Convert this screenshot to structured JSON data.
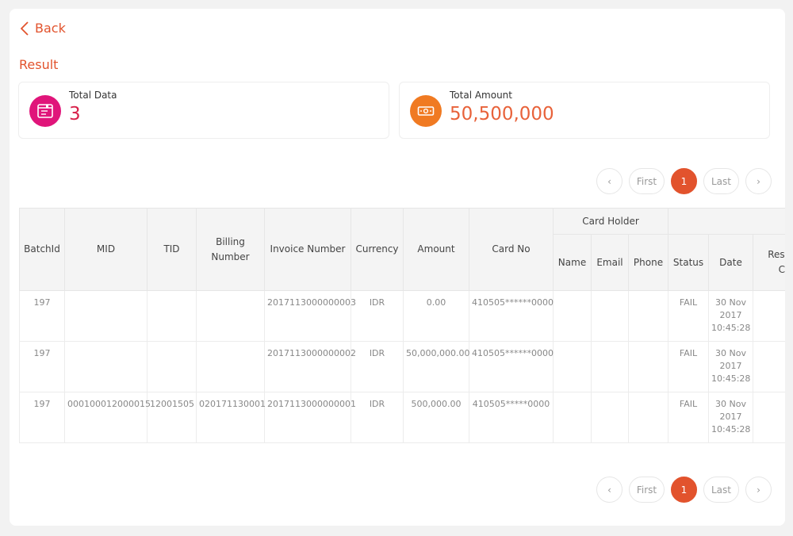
{
  "nav": {
    "back_label": "Back"
  },
  "result_title": "Result",
  "summary": {
    "total_data": {
      "label": "Total Data",
      "value": "3"
    },
    "total_amount": {
      "label": "Total Amount",
      "value": "50,500,000"
    }
  },
  "pagination": {
    "first": "First",
    "last": "Last",
    "current": "1",
    "prev_symbol": "‹",
    "next_symbol": "›"
  },
  "table": {
    "headers": {
      "batch_id": "BatchId",
      "mid": "MID",
      "tid": "TID",
      "billing_number": "Billing Number",
      "invoice_number": "Invoice Number",
      "currency": "Currency",
      "amount": "Amount",
      "card_no": "Card No",
      "card_holder": "Card Holder",
      "name": "Name",
      "email": "Email",
      "phone": "Phone",
      "status": "Status",
      "date": "Date",
      "response_code": "Response Code"
    },
    "rows": [
      {
        "batch_id": "197",
        "mid": "",
        "tid": "",
        "billing_number": "",
        "invoice_number": "2017113000000003",
        "currency": "IDR",
        "amount": "0.00",
        "card_no": "410505******0000",
        "name": "",
        "email": "",
        "phone": "",
        "status": "FAIL",
        "date": "30 Nov 2017 10:45:28"
      },
      {
        "batch_id": "197",
        "mid": "",
        "tid": "",
        "billing_number": "",
        "invoice_number": "2017113000000002",
        "currency": "IDR",
        "amount": "50,000,000.00",
        "card_no": "410505******0000",
        "name": "",
        "email": "",
        "phone": "",
        "status": "FAIL",
        "date": "30 Nov 2017 10:45:28"
      },
      {
        "batch_id": "197",
        "mid": "000100012000015",
        "tid": "12001505",
        "billing_number": "020171130001",
        "invoice_number": "2017113000000001",
        "currency": "IDR",
        "amount": "500,000.00",
        "card_no": "410505*****0000",
        "name": "",
        "email": "",
        "phone": "",
        "status": "FAIL",
        "date": "30 Nov 2017 10:45:28"
      }
    ]
  },
  "colors": {
    "accent": "#e2532d",
    "total_data_icon": "#e0157a",
    "total_amount_icon": "#f07a22"
  },
  "icons": {
    "back": "chevron-left-icon",
    "total_data": "document-list-icon",
    "total_amount": "banknote-icon"
  }
}
